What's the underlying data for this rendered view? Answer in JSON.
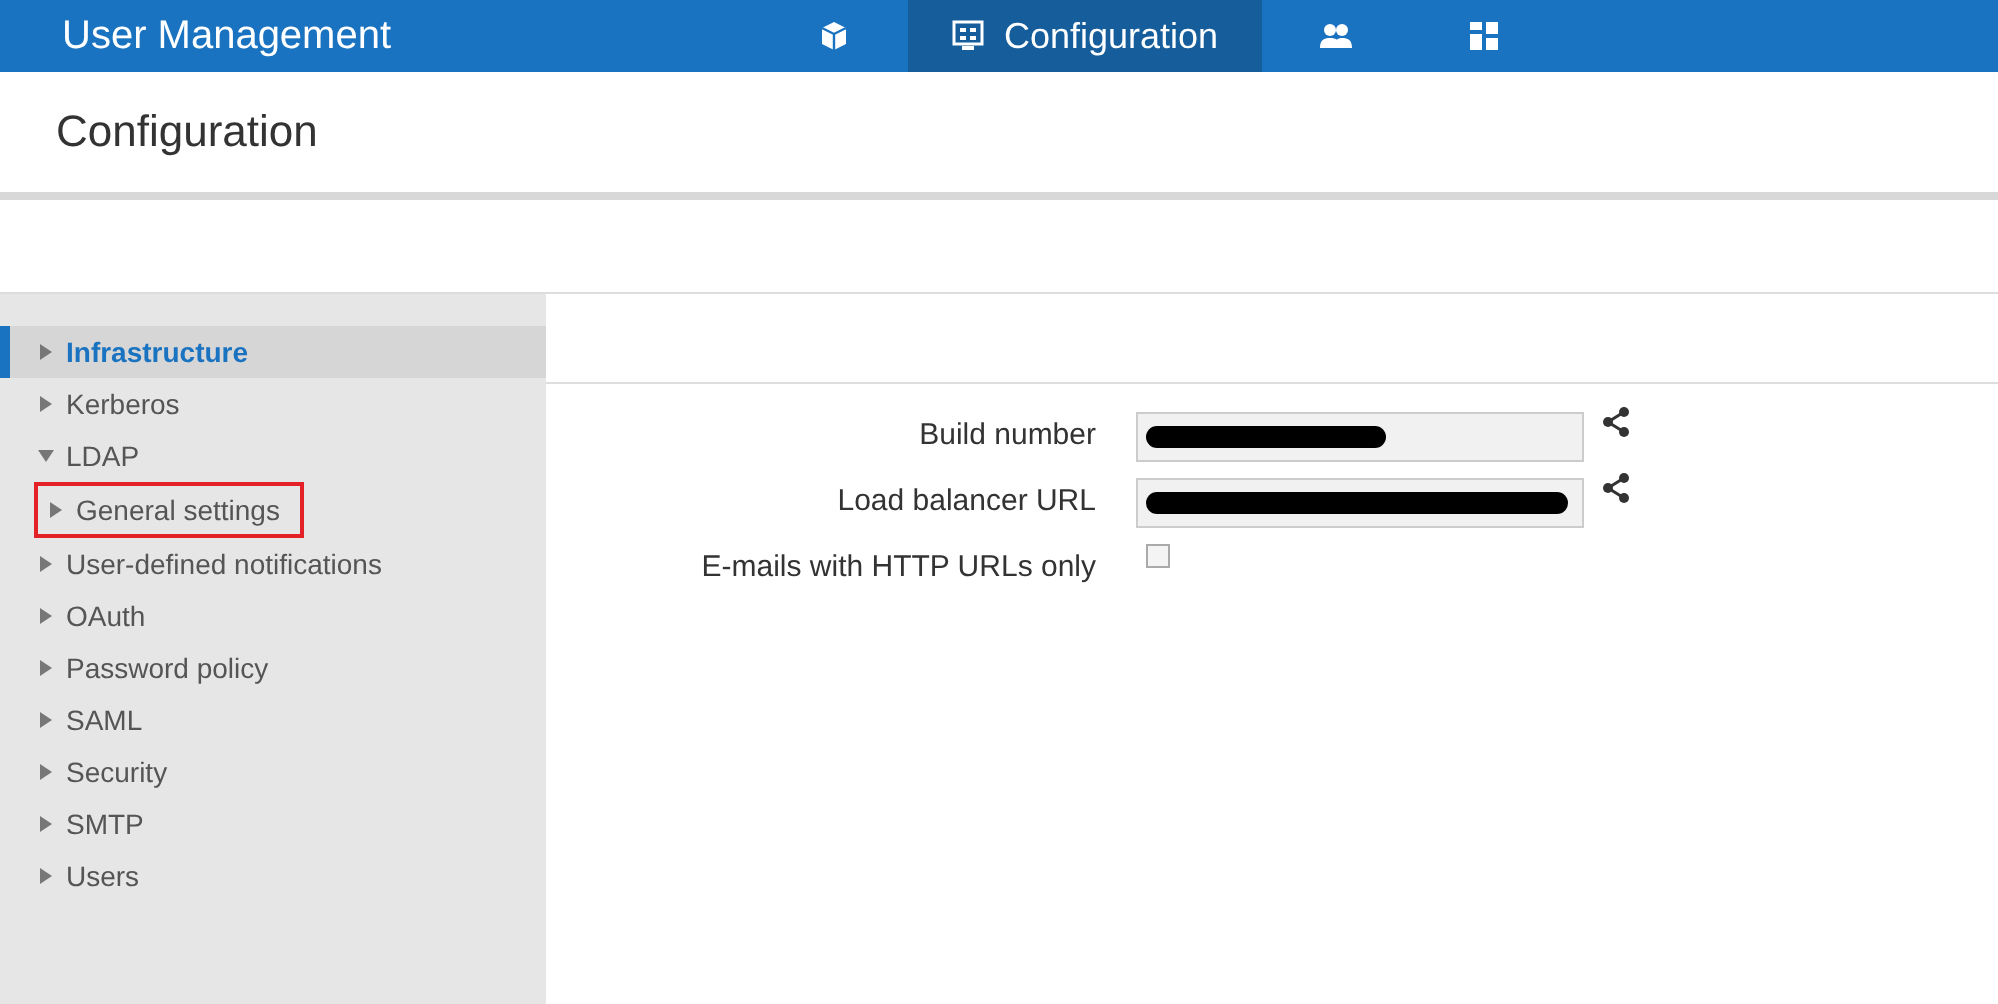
{
  "app": {
    "title": "User Management"
  },
  "tabs": [
    {
      "kind": "box",
      "selected": false
    },
    {
      "kind": "config",
      "label": "Configuration",
      "selected": true
    },
    {
      "kind": "users",
      "selected": false
    },
    {
      "kind": "dashboard",
      "selected": false
    }
  ],
  "page": {
    "title": "Configuration"
  },
  "sidebar": {
    "items": [
      {
        "label": "Infrastructure",
        "selected": true,
        "expanded": false,
        "highlighted": false
      },
      {
        "label": "Kerberos",
        "selected": false,
        "expanded": false,
        "highlighted": false
      },
      {
        "label": "LDAP",
        "selected": false,
        "expanded": true,
        "highlighted": false,
        "children": [
          {
            "label": "General settings",
            "selected": false,
            "expanded": false,
            "highlighted": true
          }
        ]
      },
      {
        "label": "User-defined notifications",
        "selected": false,
        "expanded": false,
        "highlighted": false
      },
      {
        "label": "OAuth",
        "selected": false,
        "expanded": false,
        "highlighted": false
      },
      {
        "label": "Password policy",
        "selected": false,
        "expanded": false,
        "highlighted": false
      },
      {
        "label": "SAML",
        "selected": false,
        "expanded": false,
        "highlighted": false
      },
      {
        "label": "Security",
        "selected": false,
        "expanded": false,
        "highlighted": false
      },
      {
        "label": "SMTP",
        "selected": false,
        "expanded": false,
        "highlighted": false
      },
      {
        "label": "Users",
        "selected": false,
        "expanded": false,
        "highlighted": false
      }
    ]
  },
  "form": {
    "fields": [
      {
        "kind": "text",
        "label": "Build number",
        "redacted": true,
        "share": true
      },
      {
        "kind": "text",
        "label": "Load balancer URL",
        "redacted": true,
        "share": true
      },
      {
        "kind": "checkbox",
        "label": "E-mails with HTTP URLs only",
        "checked": false
      }
    ]
  }
}
